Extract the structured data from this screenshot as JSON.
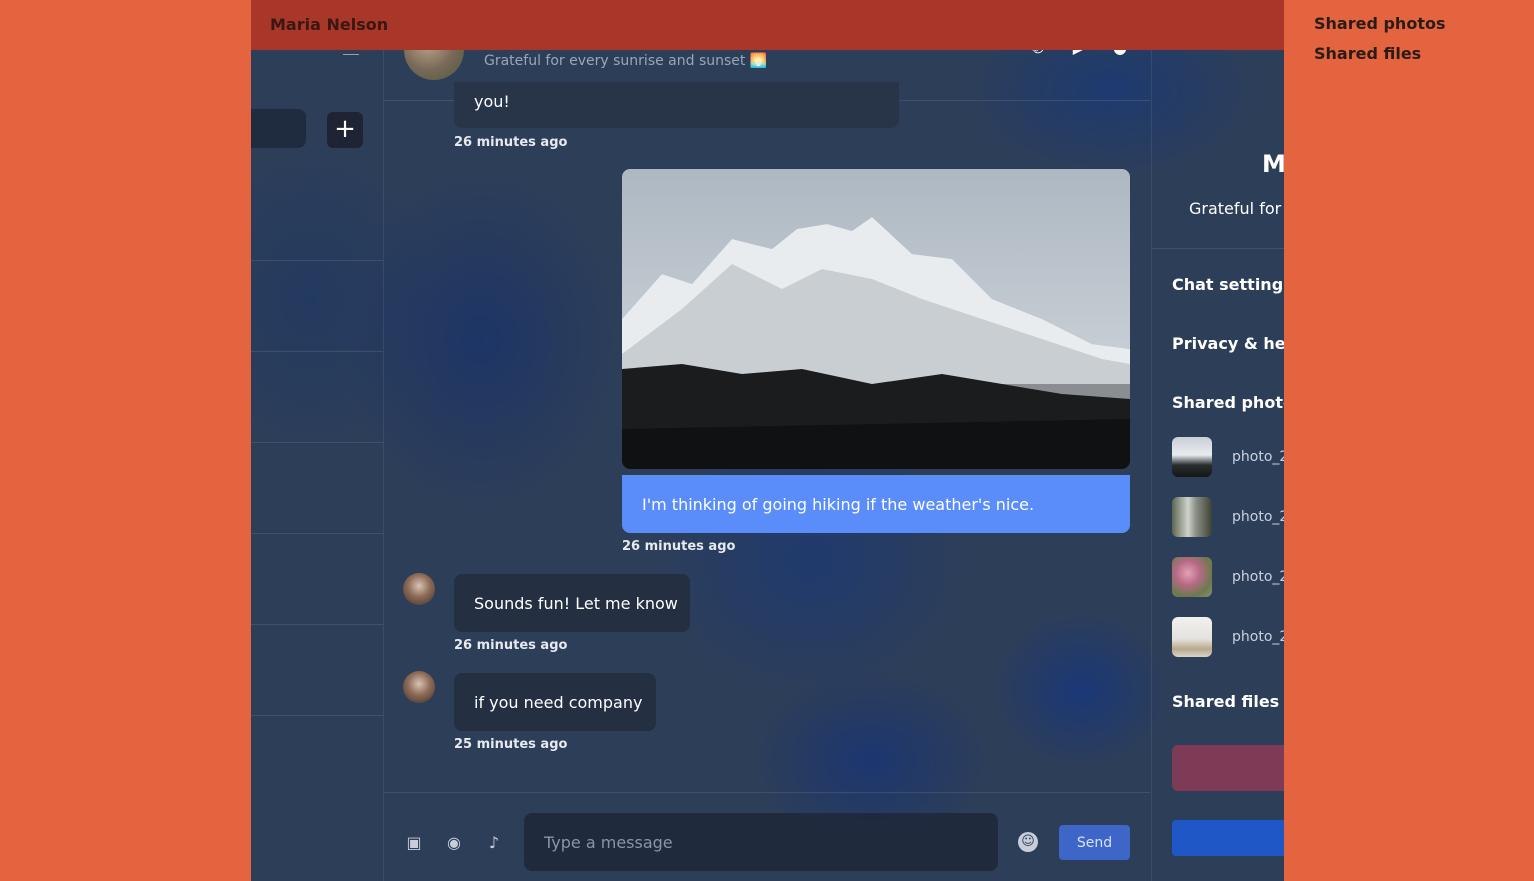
{
  "window": {
    "title": "Maria Nelson"
  },
  "overlay_links": [
    "Shared photos",
    "Shared files"
  ],
  "chat_header": {
    "status": "Grateful for every sunrise and sunset 🌅"
  },
  "left_panel": {
    "add_label": "+"
  },
  "messages": [
    {
      "id": "m1",
      "text": "you!",
      "time": "26 minutes ago",
      "direction": "in"
    },
    {
      "id": "m2",
      "text": "I'm thinking of going hiking if the weather's nice.",
      "time": "26 minutes ago",
      "direction": "out",
      "has_photo": true
    },
    {
      "id": "m3",
      "text": "Sounds fun! Let me know",
      "time": "26 minutes ago",
      "direction": "in"
    },
    {
      "id": "m4",
      "text": "if you need company",
      "time": "25 minutes ago",
      "direction": "in"
    }
  ],
  "composer": {
    "placeholder": "Type a message",
    "send_label": "Send"
  },
  "info_panel": {
    "name": "M",
    "status": "Grateful for",
    "chat_settings": "Chat settings",
    "privacy_help": "Privacy & help",
    "shared_photos": "Shared photos",
    "photos": [
      "photo_2",
      "photo_2",
      "photo_2",
      "photo_2"
    ],
    "shared_files": "Shared files"
  },
  "colors": {
    "background": "#e3643f",
    "topbar": "#a8372a",
    "outgoing_bubble": "#5a8dfa",
    "send_button": "#3e66c9"
  }
}
